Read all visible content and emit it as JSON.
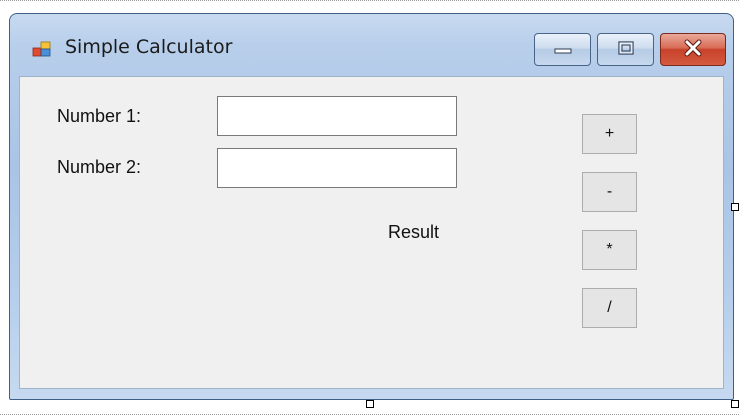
{
  "window": {
    "title": "Simple Calculator"
  },
  "form": {
    "number1_label": "Number 1:",
    "number2_label": "Number 2:",
    "number1_value": "",
    "number2_value": "",
    "result_label": "Result"
  },
  "operations": {
    "add": "+",
    "subtract": "-",
    "multiply": "*",
    "divide": "/"
  },
  "colors": {
    "form_background": "#f0f0f0",
    "titlebar_accent": "#b8cfeb",
    "close_button": "#c7422a"
  },
  "icons": {
    "app": "app-window-icon",
    "minimize": "minimize-icon",
    "maximize": "maximize-icon",
    "close": "close-icon"
  }
}
